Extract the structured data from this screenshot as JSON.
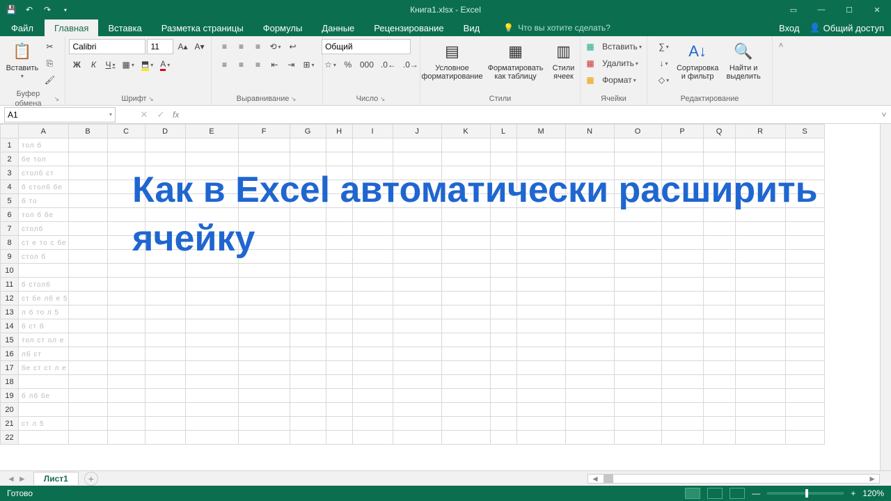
{
  "title": "Книга1.xlsx - Excel",
  "qat": {
    "save": "save-icon",
    "undo": "undo-icon",
    "redo": "redo-icon"
  },
  "tabs": {
    "file": "Файл",
    "items": [
      "Главная",
      "Вставка",
      "Разметка страницы",
      "Формулы",
      "Данные",
      "Рецензирование",
      "Вид"
    ],
    "active": 0,
    "tellme": "Что вы хотите сделать?",
    "signin": "Вход",
    "share": "Общий доступ"
  },
  "ribbon": {
    "clipboard": {
      "paste": "Вставить",
      "label": "Буфер обмена"
    },
    "font": {
      "name": "Calibri",
      "size": "11",
      "label": "Шрифт",
      "bold": "Ж",
      "italic": "К",
      "underline": "Ч"
    },
    "align": {
      "label": "Выравнивание"
    },
    "number": {
      "format": "Общий",
      "label": "Число"
    },
    "styles": {
      "cond": "Условное форматирование",
      "table": "Форматировать как таблицу",
      "cell": "Стили ячеек",
      "label": "Стили"
    },
    "cells": {
      "insert": "Вставить",
      "delete": "Удалить",
      "format": "Формат",
      "label": "Ячейки"
    },
    "editing": {
      "sort": "Сортировка и фильтр",
      "find": "Найти и выделить",
      "label": "Редактирование"
    }
  },
  "namebox": "A1",
  "columns": [
    "A",
    "B",
    "C",
    "D",
    "E",
    "F",
    "G",
    "H",
    "I",
    "J",
    "K",
    "L",
    "M",
    "N",
    "O",
    "P",
    "Q",
    "R",
    "S"
  ],
  "rows": 22,
  "overlay": "Как в Excel автоматически расширить ячейку",
  "sheet": "Лист1",
  "status": {
    "ready": "Готово",
    "zoom": "120%"
  }
}
